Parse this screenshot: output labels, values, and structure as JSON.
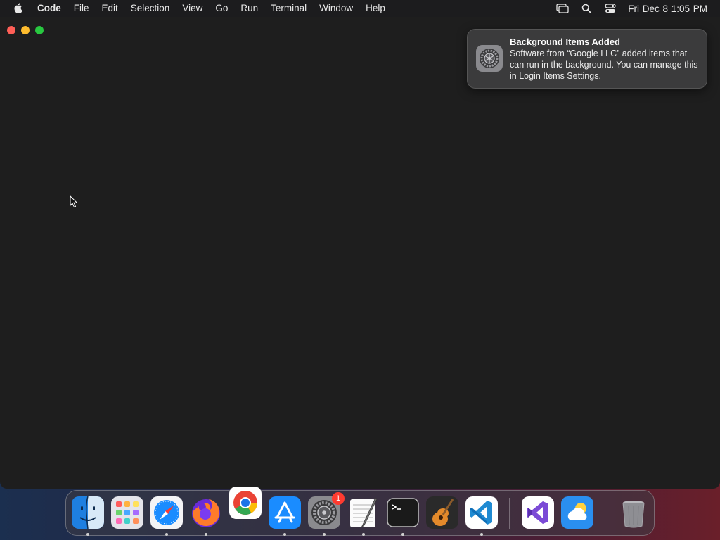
{
  "menubar": {
    "app_name": "Code",
    "items": [
      "File",
      "Edit",
      "Selection",
      "View",
      "Go",
      "Run",
      "Terminal",
      "Window",
      "Help"
    ],
    "clock": "Fri Dec 8  1:05 PM"
  },
  "notification": {
    "title": "Background Items Added",
    "body": "Software from “Google LLC” added items that can run in the background. You can manage this in Login Items Settings."
  },
  "dock": {
    "apps": [
      {
        "name": "Finder",
        "icon": "finder-icon",
        "running": true
      },
      {
        "name": "Launchpad",
        "icon": "launchpad-icon",
        "running": false
      },
      {
        "name": "Safari",
        "icon": "safari-icon",
        "running": true
      },
      {
        "name": "Firefox",
        "icon": "firefox-icon",
        "running": true
      },
      {
        "name": "Google Chrome",
        "icon": "chrome-icon",
        "running": false
      },
      {
        "name": "App Store",
        "icon": "app-store-icon",
        "running": true
      },
      {
        "name": "System Settings",
        "icon": "system-settings-icon",
        "running": true,
        "badge": "1"
      },
      {
        "name": "TextEdit",
        "icon": "textedit-icon",
        "running": true
      },
      {
        "name": "Terminal",
        "icon": "terminal-icon",
        "running": true
      },
      {
        "name": "GarageBand",
        "icon": "garageband-icon",
        "running": false
      },
      {
        "name": "Visual Studio Code",
        "icon": "vscode-icon",
        "running": true
      },
      {
        "name": "Visual Studio",
        "icon": "visual-studio-icon",
        "running": false
      },
      {
        "name": "Weather",
        "icon": "weather-icon",
        "running": false
      },
      {
        "name": "Trash",
        "icon": "trash-icon",
        "running": false
      }
    ]
  }
}
